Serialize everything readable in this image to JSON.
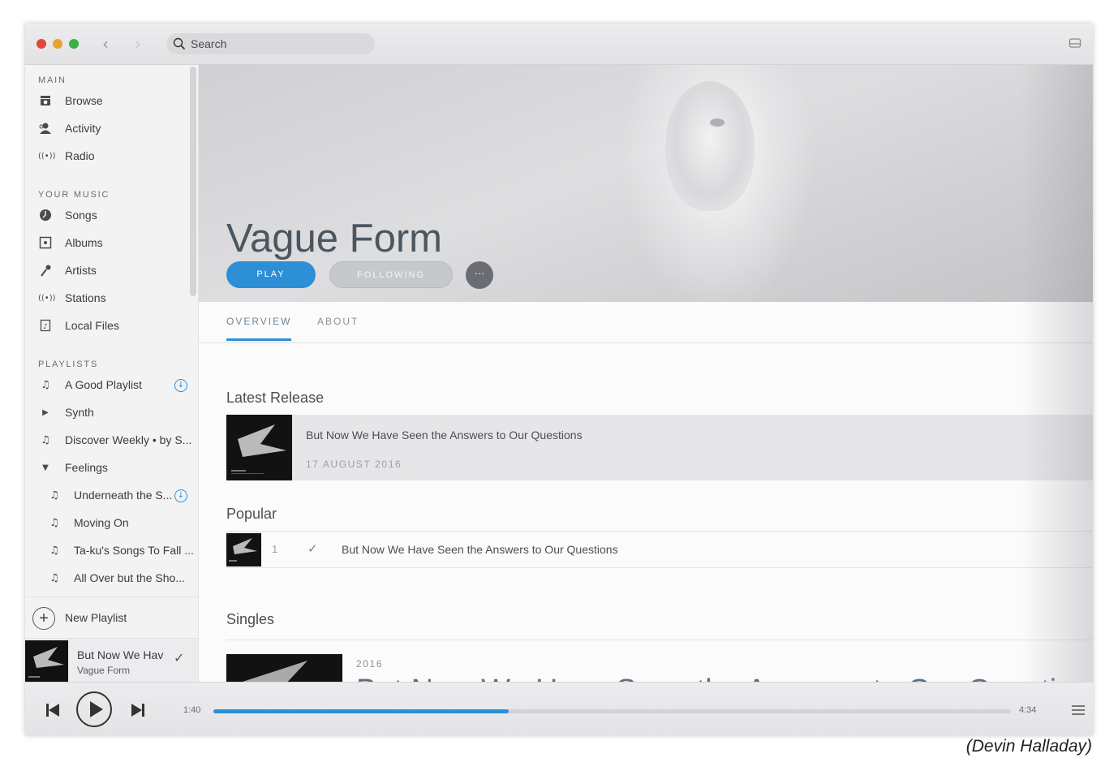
{
  "search": {
    "placeholder": "Search"
  },
  "sidebar": {
    "main_header": "MAIN",
    "main_items": [
      {
        "label": "Browse",
        "icon": "browse-icon"
      },
      {
        "label": "Activity",
        "icon": "activity-icon"
      },
      {
        "label": "Radio",
        "icon": "radio-icon"
      }
    ],
    "your_music_header": "YOUR MUSIC",
    "your_music_items": [
      {
        "label": "Songs",
        "icon": "songs-icon"
      },
      {
        "label": "Albums",
        "icon": "albums-icon"
      },
      {
        "label": "Artists",
        "icon": "artists-icon"
      },
      {
        "label": "Stations",
        "icon": "stations-icon"
      },
      {
        "label": "Local Files",
        "icon": "local-files-icon"
      }
    ],
    "playlists_header": "PLAYLISTS",
    "playlists": [
      {
        "label": "A Good Playlist",
        "icon": "music-note-icon",
        "downloaded": true
      },
      {
        "label": "Synth",
        "icon": "caret-right-icon"
      },
      {
        "label": "Discover Weekly • by S...",
        "icon": "music-note-icon"
      },
      {
        "label": "Feelings",
        "icon": "caret-down-icon"
      },
      {
        "label": "Underneath the S...",
        "icon": "music-note-icon",
        "downloaded": true
      },
      {
        "label": "Moving On",
        "icon": "music-note-icon"
      },
      {
        "label": "Ta-ku's Songs To Fall ...",
        "icon": "music-note-icon"
      },
      {
        "label": "All Over but the Sho...",
        "icon": "music-note-icon"
      }
    ],
    "new_playlist": "New Playlist"
  },
  "now_playing": {
    "title": "But Now We Hav",
    "artist": "Vague Form"
  },
  "artist": {
    "name": "Vague Form",
    "play_label": "PLAY",
    "following_label": "FOLLOWING",
    "more_label": "···"
  },
  "tabs": {
    "overview": "OVERVIEW",
    "about": "ABOUT"
  },
  "latest_release": {
    "header": "Latest Release",
    "title": "But Now We Have Seen the Answers to Our Questions",
    "date": "17 AUGUST 2016"
  },
  "popular": {
    "header": "Popular",
    "tracks": [
      {
        "number": "1",
        "title": "But Now We Have Seen the Answers to Our Questions"
      }
    ]
  },
  "singles": {
    "header": "Singles",
    "year": "2016",
    "title": "But Now We Have Seen the Answers to Our Questions"
  },
  "player": {
    "current_time": "1:40",
    "total_time": "4:34",
    "progress": 0.37
  },
  "colors": {
    "accent": "#2d8fd6",
    "title_text": "#4c5660"
  },
  "credit": "(Devin Halladay)"
}
